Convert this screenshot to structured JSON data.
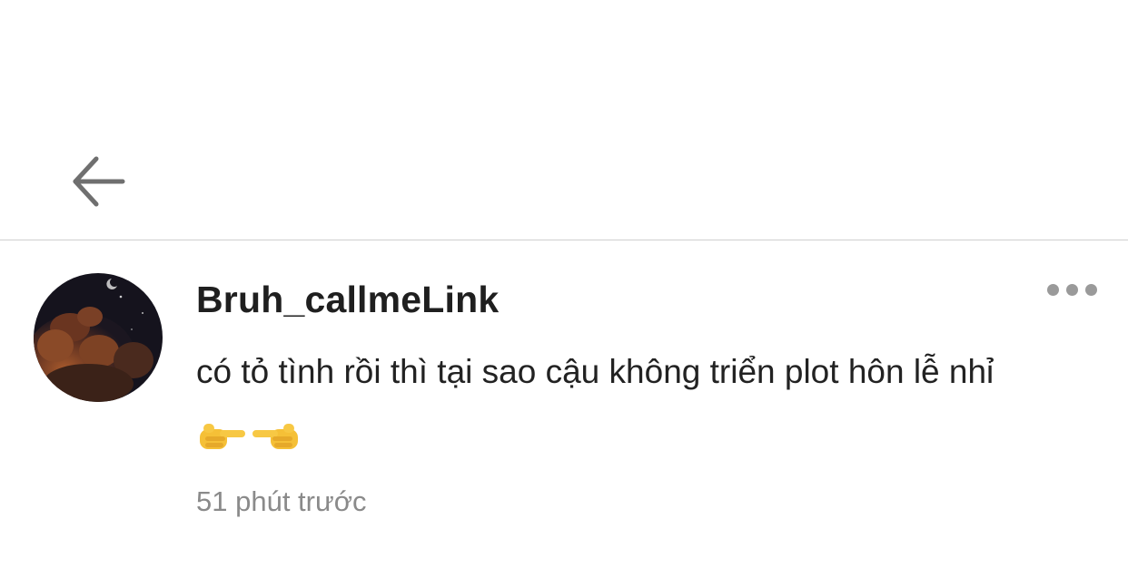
{
  "header": {
    "back_icon": "arrow-left-icon"
  },
  "comment": {
    "avatar_icon": "avatar-night-clouds",
    "username": "Bruh_callmeLink",
    "text": "có tỏ tình rồi thì tại sao cậu không triển plot hôn lễ nhỉ",
    "emojis": [
      "backhand-index-pointing-right-icon",
      "backhand-index-pointing-left-icon"
    ],
    "timestamp": "51 phút trước",
    "more_icon": "more-horizontal-icon"
  },
  "colors": {
    "background": "#ffffff",
    "divider": "#cfcfcf",
    "username": "#1f1f1f",
    "text": "#222222",
    "timestamp": "#8a8a8a",
    "icon_gray": "#6f6f6f",
    "dots": "#9a9a9a"
  }
}
